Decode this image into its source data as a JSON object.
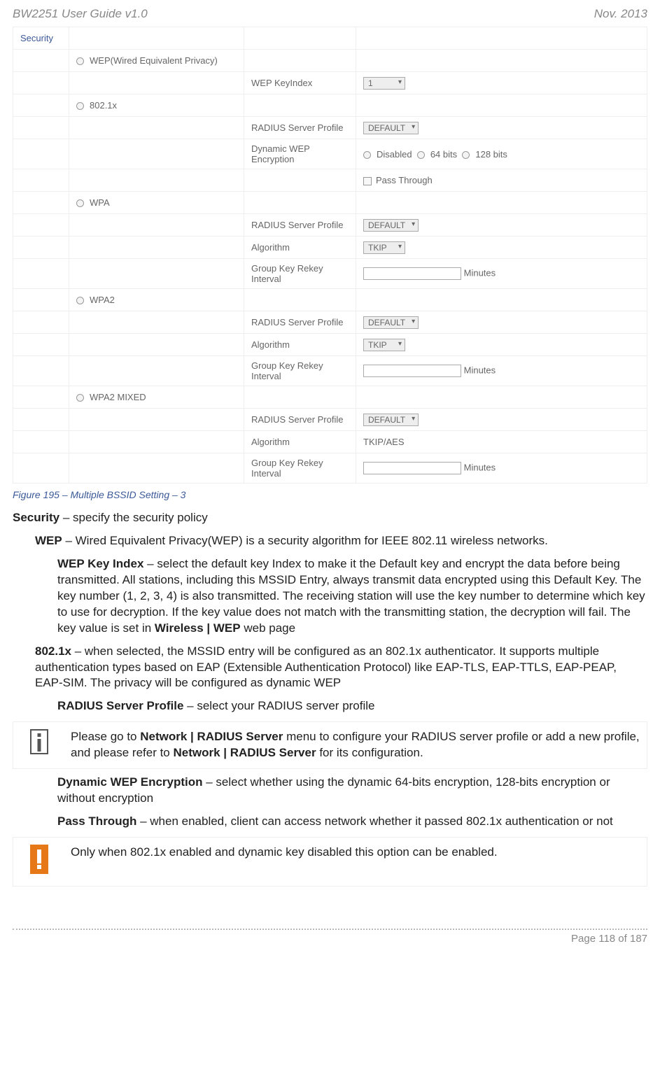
{
  "header": {
    "left": "BW2251 User Guide v1.0",
    "right": "Nov.  2013"
  },
  "table": {
    "security_label": "Security",
    "wep_label": "WEP(Wired Equivalent Privacy)",
    "wep_keyindex_label": "WEP KeyIndex",
    "wep_keyindex_value": "1",
    "x8021_label": "802.1x",
    "radius_label": "RADIUS Server Profile",
    "radius_value": "DEFAULT",
    "dyn_wep_label": "Dynamic WEP Encryption",
    "dyn_disabled": "Disabled",
    "dyn_64": "64 bits",
    "dyn_128": "128 bits",
    "pass_through": "Pass Through",
    "wpa_label": "WPA",
    "algorithm_label": "Algorithm",
    "algorithm_value": "TKIP",
    "group_key_label": "Group Key Rekey Interval",
    "minutes": "Minutes",
    "wpa2_label": "WPA2",
    "wpa2mixed_label": "WPA2 MIXED",
    "tkipaes": "TKIP/AES"
  },
  "caption": "Figure 195 – Multiple BSSID Setting – 3",
  "body": {
    "security_b": "Security",
    "security_t": " – specify the security policy",
    "wep_b": "WEP",
    "wep_t": " – Wired Equivalent Privacy(WEP) is a security algorithm for IEEE 802.11 wireless networks.",
    "wki_b": "WEP Key Index",
    "wki_t": " – select the default key Index to make it the Default key and encrypt the data before being transmitted. All stations, including this MSSID Entry, always transmit data encrypted using this Default Key. The key number (1, 2, 3, 4) is also transmitted. The receiving station will use the key number to determine which key to use for decryption. If the key value does not match with the transmitting station, the decryption will fail. The key value is set in ",
    "wki_b2": "Wireless | WEP",
    "wki_t2": " web page",
    "x_b": "802.1x",
    "x_t": " – when selected, the MSSID entry will be configured as an 802.1x authenticator. It supports multiple authentication types based on EAP (Extensible Authentication Protocol) like EAP-TLS, EAP-TTLS, EAP-PEAP, EAP-SIM. The privacy will be configured as dynamic WEP",
    "rsp_b": "RADIUS Server Profile",
    "rsp_t": " – select your RADIUS server profile",
    "note1_a": "Please go to ",
    "note1_b1": "Network | RADIUS Server",
    "note1_c": " menu to configure your RADIUS server profile or add a new profile, and please refer to ",
    "note1_b2": "Network | RADIUS Server",
    "note1_d": " for its configuration.",
    "dwe_b": "Dynamic WEP Encryption",
    "dwe_t": " – select whether using the dynamic 64-bits encryption, 128-bits encryption or without encryption",
    "pt_b": "Pass Through",
    "pt_t": " – when enabled, client can access network whether it passed 802.1x authentication or not",
    "warn": "Only when 802.1x enabled and dynamic key disabled this option can be enabled."
  },
  "footer": "Page 118 of 187"
}
